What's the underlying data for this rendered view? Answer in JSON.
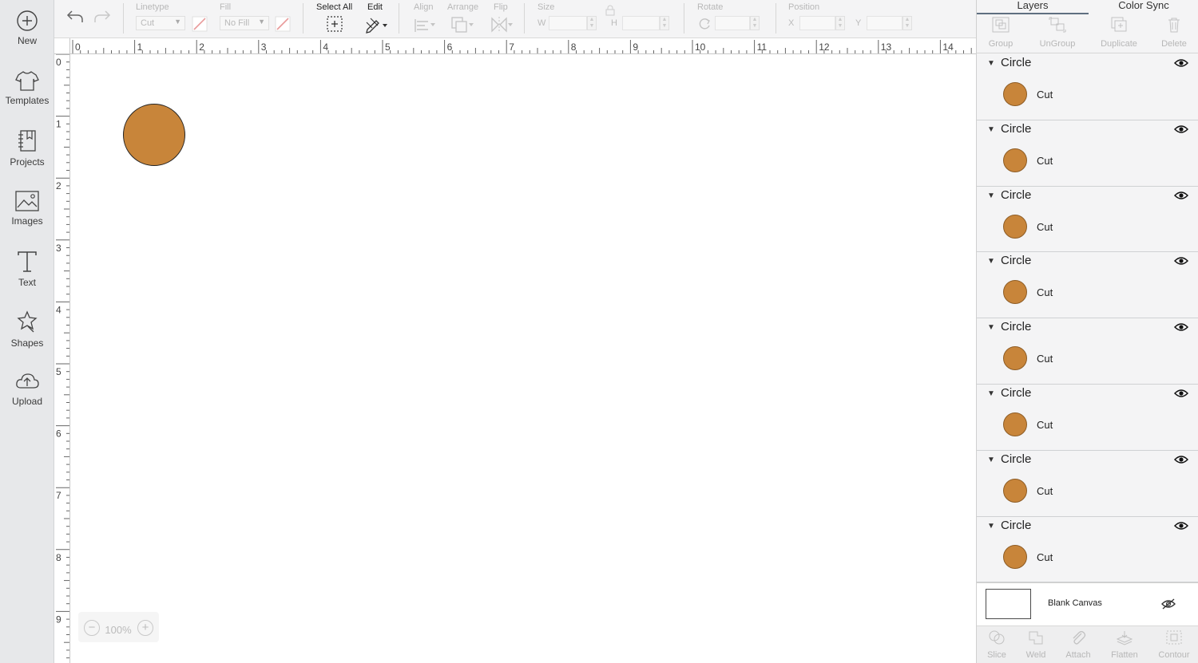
{
  "sidebar": {
    "items": [
      {
        "label": "New",
        "icon": "plus-circle-icon"
      },
      {
        "label": "Templates",
        "icon": "tshirt-icon"
      },
      {
        "label": "Projects",
        "icon": "notebook-icon"
      },
      {
        "label": "Images",
        "icon": "image-icon"
      },
      {
        "label": "Text",
        "icon": "text-icon"
      },
      {
        "label": "Shapes",
        "icon": "shapes-icon"
      },
      {
        "label": "Upload",
        "icon": "cloud-upload-icon"
      }
    ]
  },
  "toolbar": {
    "undo_icon": "undo-icon",
    "redo_icon": "redo-icon",
    "linetype": {
      "label": "Linetype",
      "value": "Cut"
    },
    "fill": {
      "label": "Fill",
      "value": "No Fill"
    },
    "select_all": {
      "label": "Select All"
    },
    "edit": {
      "label": "Edit"
    },
    "align": {
      "label": "Align"
    },
    "arrange": {
      "label": "Arrange"
    },
    "flip": {
      "label": "Flip"
    },
    "size": {
      "label": "Size",
      "w_label": "W",
      "h_label": "H"
    },
    "rotate": {
      "label": "Rotate"
    },
    "position": {
      "label": "Position",
      "x_label": "X",
      "y_label": "Y"
    }
  },
  "ruler": {
    "horizontal": [
      "0",
      "1",
      "2",
      "3",
      "4",
      "5",
      "6",
      "7",
      "8",
      "9",
      "10",
      "11",
      "12",
      "13",
      "14"
    ],
    "vertical": [
      "0",
      "1",
      "2",
      "3",
      "4",
      "5",
      "6",
      "7",
      "8",
      "9"
    ]
  },
  "canvas": {
    "zoom_level": "100%",
    "shape_color": "#c8853a"
  },
  "panel": {
    "tabs": [
      "Layers",
      "Color Sync"
    ],
    "active_tab": "Layers",
    "actions": [
      "Group",
      "UnGroup",
      "Duplicate",
      "Delete"
    ],
    "layers": [
      {
        "name": "Circle",
        "operation": "Cut",
        "color": "#c8853a"
      },
      {
        "name": "Circle",
        "operation": "Cut",
        "color": "#c8853a"
      },
      {
        "name": "Circle",
        "operation": "Cut",
        "color": "#c8853a"
      },
      {
        "name": "Circle",
        "operation": "Cut",
        "color": "#c8853a"
      },
      {
        "name": "Circle",
        "operation": "Cut",
        "color": "#c8853a"
      },
      {
        "name": "Circle",
        "operation": "Cut",
        "color": "#c8853a"
      },
      {
        "name": "Circle",
        "operation": "Cut",
        "color": "#c8853a"
      },
      {
        "name": "Circle",
        "operation": "Cut",
        "color": "#c8853a"
      }
    ],
    "blank_canvas": {
      "label": "Blank Canvas"
    },
    "bottom_actions": [
      "Slice",
      "Weld",
      "Attach",
      "Flatten",
      "Contour"
    ]
  }
}
